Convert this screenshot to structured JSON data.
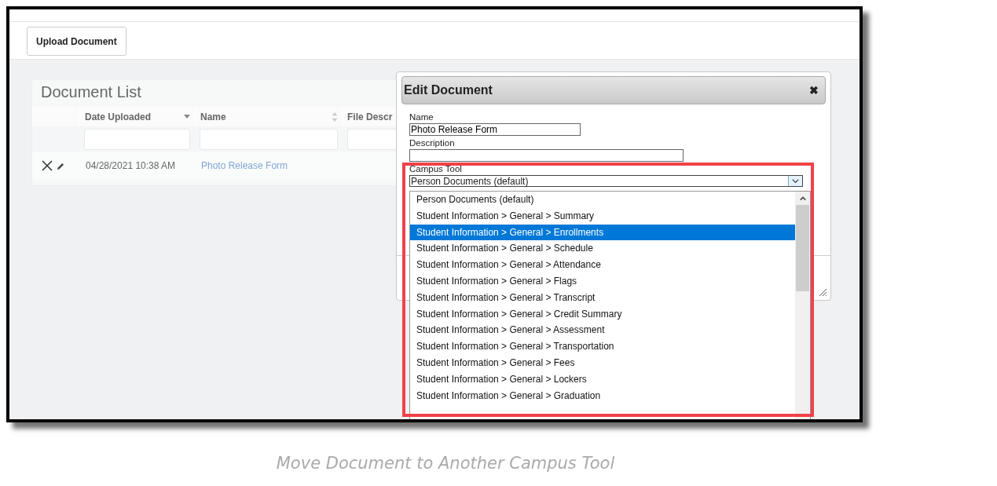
{
  "toolbar": {
    "upload_button": "Upload Document"
  },
  "document_list": {
    "title": "Document List",
    "columns": [
      {
        "label": "Date Uploaded",
        "sorted": true
      },
      {
        "label": "Name",
        "sorted": false
      },
      {
        "label": "File Descr"
      }
    ],
    "rows": [
      {
        "date": "04/28/2021 10:38 AM",
        "name": "Photo Release Form"
      }
    ]
  },
  "dialog": {
    "title": "Edit Document",
    "close": "✖",
    "name_label": "Name",
    "name_value": "Photo Release Form",
    "description_label": "Description",
    "campus_tool_label": "Campus Tool",
    "campus_tool_value": "Person Documents (default)",
    "options": [
      {
        "label": "Person Documents (default)",
        "selected": false
      },
      {
        "label": "Student Information > General > Summary",
        "selected": false
      },
      {
        "label": "Student Information > General > Enrollments",
        "selected": true
      },
      {
        "label": "Student Information > General > Schedule",
        "selected": false
      },
      {
        "label": "Student Information > General > Attendance",
        "selected": false
      },
      {
        "label": "Student Information > General > Flags",
        "selected": false
      },
      {
        "label": "Student Information > General > Transcript",
        "selected": false
      },
      {
        "label": "Student Information > General > Credit Summary",
        "selected": false
      },
      {
        "label": "Student Information > General > Assessment",
        "selected": false
      },
      {
        "label": "Student Information > General > Transportation",
        "selected": false
      },
      {
        "label": "Student Information > General > Fees",
        "selected": false
      },
      {
        "label": "Student Information > General > Lockers",
        "selected": false
      },
      {
        "label": "Student Information > General > Graduation",
        "selected": false
      }
    ]
  },
  "caption": "Move Document to Another Campus Tool"
}
